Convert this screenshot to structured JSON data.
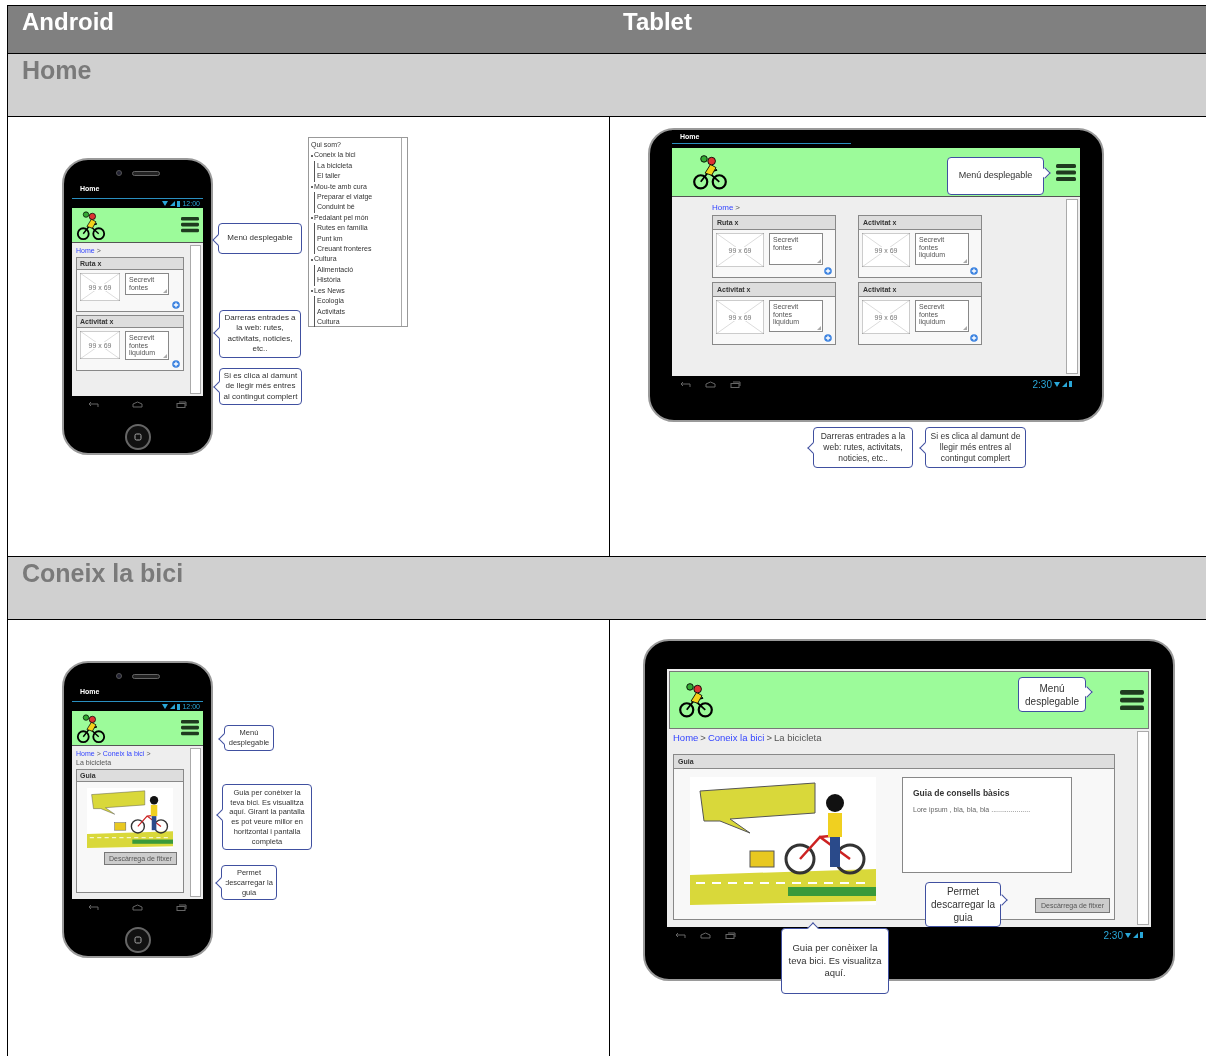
{
  "table": {
    "columns": [
      "Android",
      "Tablet"
    ]
  },
  "sections": [
    {
      "title": "Home",
      "phone": {
        "tab": "Home",
        "time": "12:00",
        "breadcrumb": [
          {
            "text": "Home",
            "link": true
          },
          {
            "text": ">",
            "link": false
          }
        ],
        "content": {
          "kind": "cards",
          "cards": [
            {
              "title": "Ruta x",
              "image": "99 x 69",
              "text": "Secrevit fontes"
            },
            {
              "title": "Activitat x",
              "image": "99 x 69",
              "text": "Secrevit fontes liquidum"
            }
          ]
        },
        "callouts": [
          "Menú desplegable",
          "Darreras entrades a la web: rutes, activitats, noticies, etc..",
          "Si es clica al damunt de llegir més entres al contingut complert"
        ],
        "menu_tree": [
          {
            "label": "Qui som?"
          },
          {
            "label": "Coneix la bici",
            "children": [
              {
                "label": "La bicicleta"
              },
              {
                "label": "El taller"
              }
            ]
          },
          {
            "label": "Mou-te amb cura",
            "children": [
              {
                "label": "Preparar el viatge"
              },
              {
                "label": "Conduint bé"
              }
            ]
          },
          {
            "label": "Pedalant pel món",
            "children": [
              {
                "label": "Rutes en família"
              },
              {
                "label": "Punt km"
              },
              {
                "label": "Creuant fronteres"
              }
            ]
          },
          {
            "label": "Cultura",
            "children": [
              {
                "label": "Alimentació"
              },
              {
                "label": "Història"
              }
            ]
          },
          {
            "label": "Les News",
            "children": [
              {
                "label": "Ecologia"
              },
              {
                "label": "Activitats"
              },
              {
                "label": "Cultura"
              }
            ]
          }
        ]
      },
      "tablet": {
        "tab": "Home",
        "time": "2:30",
        "menu_callout": "Menú desplegable",
        "breadcrumb": [
          {
            "text": "Home",
            "link": true
          },
          {
            "text": ">",
            "link": false
          }
        ],
        "content": {
          "kind": "cards",
          "cards": [
            {
              "title": "Ruta x",
              "image": "99 x 69",
              "text": "Secrevit fontes"
            },
            {
              "title": "Activitat x",
              "image": "99 x 69",
              "text": "Secrevit fontes liquidum"
            },
            {
              "title": "Activitat x",
              "image": "99 x 69",
              "text": "Secrevit fontes liquidum"
            },
            {
              "title": "Activitat x",
              "image": "99 x 69",
              "text": "Secrevit fontes liquidum"
            }
          ]
        },
        "callouts": [
          "Darreras entrades a la web: rutes, activitats, noticies, etc..",
          "Si es clica al damunt de llegir més entres al contingut complert"
        ]
      }
    },
    {
      "title": "Coneix la bici",
      "phone": {
        "tab": "Home",
        "time": "12:00",
        "breadcrumb": [
          {
            "text": "Home",
            "link": true
          },
          {
            "text": ">",
            "link": false
          },
          {
            "text": "Coneix la bici",
            "link": true
          },
          {
            "text": ">",
            "link": false
          },
          {
            "text": "La bicicleta",
            "link": false
          }
        ],
        "content": {
          "kind": "guide",
          "title": "Guia",
          "button": "Descàrrega de fitxer"
        },
        "callouts": [
          "Menú desplegable",
          "Guia per conèixer la teva bici. Es visualitza aquí. Girant la pantalla es pot veure millor en horitzontal i pantalla completa",
          "Permet descarregar la guia"
        ]
      },
      "tablet": {
        "time": "2:30",
        "menu_callout": "Menú desplegable",
        "breadcrumb": [
          {
            "text": "Home",
            "link": true
          },
          {
            "text": ">",
            "link": false
          },
          {
            "text": "Coneix la bici",
            "link": true
          },
          {
            "text": ">",
            "link": false
          },
          {
            "text": "La bicicleta",
            "link": false
          }
        ],
        "content": {
          "kind": "guide",
          "title": "Guia",
          "info_title": "Guia de consells bàsics",
          "info_text": "Lore ipsum , bla, bla, bla ....................",
          "button": "Descàrrega de fitxer"
        },
        "callouts": [
          "Permet descarregar la guia",
          "Guia per conèixer la teva bici. Es visualitza aquí."
        ]
      }
    }
  ]
}
